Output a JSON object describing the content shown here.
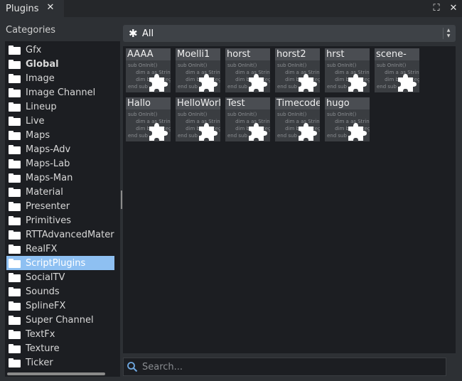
{
  "window": {
    "tab_title": "Plugins",
    "close_glyph": "✕",
    "maximize_glyph": "⛶",
    "window_close_glyph": "✕"
  },
  "categories": {
    "label": "Categories",
    "items": [
      {
        "label": "Gfx"
      },
      {
        "label": "Global",
        "bold": true
      },
      {
        "label": "Image"
      },
      {
        "label": "Image Channel"
      },
      {
        "label": "Lineup"
      },
      {
        "label": "Live"
      },
      {
        "label": "Maps"
      },
      {
        "label": "Maps-Adv"
      },
      {
        "label": "Maps-Lab"
      },
      {
        "label": "Maps-Man"
      },
      {
        "label": "Material"
      },
      {
        "label": "Presenter"
      },
      {
        "label": "Primitives"
      },
      {
        "label": "RTTAdvancedMateria"
      },
      {
        "label": "RealFX"
      },
      {
        "label": "ScriptPlugins",
        "selected": true
      },
      {
        "label": "SocialTV"
      },
      {
        "label": "Sounds"
      },
      {
        "label": "SplineFX"
      },
      {
        "label": "Super Channel"
      },
      {
        "label": "TextFx"
      },
      {
        "label": "Texture"
      },
      {
        "label": "Ticker"
      }
    ]
  },
  "filter": {
    "icon": "asterisk-icon",
    "value": "All"
  },
  "plugins": {
    "code_preview": "sub OnInit()\n     dim a as String\n     dim b as Integer\nend sub",
    "items": [
      {
        "name": "AAAA"
      },
      {
        "name": "Moelli1"
      },
      {
        "name": "horst"
      },
      {
        "name": "horst2"
      },
      {
        "name": "hrst"
      },
      {
        "name": "scene-"
      },
      {
        "name": "Hallo"
      },
      {
        "name": "HelloWorl"
      },
      {
        "name": "Test"
      },
      {
        "name": "Timecode"
      },
      {
        "name": "hugo"
      }
    ]
  },
  "search": {
    "placeholder": "Search...",
    "value": ""
  },
  "colors": {
    "selection": "#8ec0f2",
    "panel_bg": "#1c1e22",
    "window_bg": "#2d3034"
  }
}
